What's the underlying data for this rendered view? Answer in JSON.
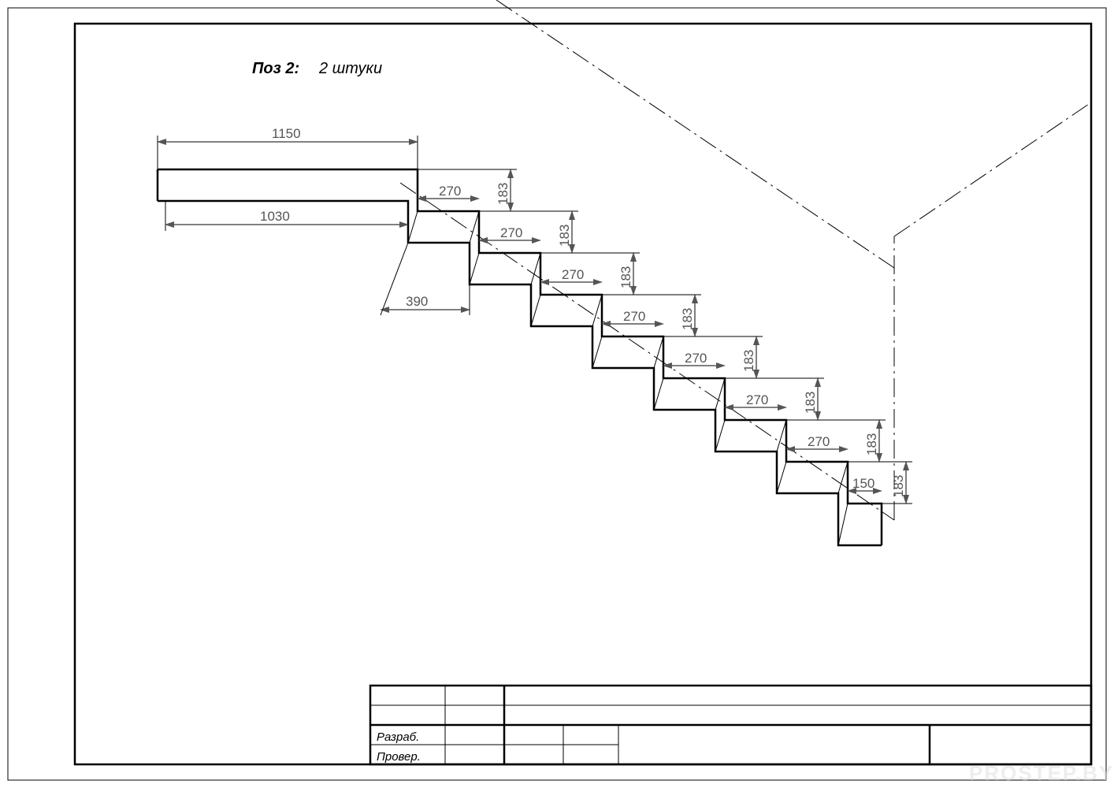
{
  "title": {
    "label": "Поз 2:",
    "qty": "2 штуки"
  },
  "dimensions": {
    "top_width": "1150",
    "inner_width": "1030",
    "first_run_bottom": "390",
    "tread": "270",
    "riser": "183",
    "last_tread": "150",
    "last_riser": "183"
  },
  "titleblock": {
    "row1": "Разраб.",
    "row2": "Провер."
  },
  "watermark": "PROSTEP.BY",
  "steps": [
    {
      "tread": "270",
      "riser": "183"
    },
    {
      "tread": "270",
      "riser": "183"
    },
    {
      "tread": "270",
      "riser": "183"
    },
    {
      "tread": "270",
      "riser": "183"
    },
    {
      "tread": "270",
      "riser": "183"
    },
    {
      "tread": "270",
      "riser": "183"
    },
    {
      "tread": "270",
      "riser": "183"
    }
  ]
}
